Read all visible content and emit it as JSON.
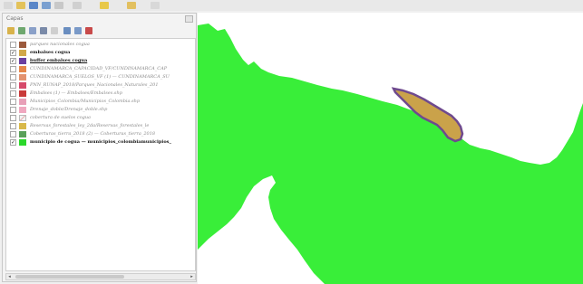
{
  "layers_panel": {
    "title": "Capas",
    "layers": [
      {
        "label": "parques nacionales cogua",
        "checked": false,
        "swatch": "#9b5a3c"
      },
      {
        "label": "embalses cogua",
        "checked": true,
        "swatch": "#d1a84a"
      },
      {
        "label": "buffer embalses cogua",
        "checked": true,
        "swatch": "#6b3fa0"
      },
      {
        "label": "CUNDINAMARCA_CAPACIDAD_VF/CUNDINAMARCA_CAP",
        "checked": false,
        "swatch": "#e6874a"
      },
      {
        "label": "CUNDINAMARCA_SUELOS_VF (1) — CUNDINAMARCA_SU",
        "checked": false,
        "swatch": "#e3926f"
      },
      {
        "label": "PNN_RUNAP_2018/Parques_Nacionales_Naturales_201",
        "checked": false,
        "swatch": "#d64a6b"
      },
      {
        "label": "Embalses (1) — Embalses/Embalses.shp",
        "checked": false,
        "swatch": "#c93a3a"
      },
      {
        "label": "Municipios_Colombia/Municipios_Colombia.shp",
        "checked": false,
        "swatch": "#e8a0b8"
      },
      {
        "label": "Drenaje_doble/Drenaje_doble.shp",
        "checked": false,
        "swatch": "#f0a8c0"
      },
      {
        "label": "cobertura de suelos cogua",
        "checked": false,
        "swatch": "#e0e0e0"
      },
      {
        "label": "Reservas_forestales_ley_2da/Reservas_forestales_le",
        "checked": false,
        "swatch": "#d8b84a"
      },
      {
        "label": "Coberturas_tierra_2018 (2) — Coberturas_tierra_2018",
        "checked": false,
        "swatch": "#5aa05a"
      },
      {
        "label": "municipio de cogua — municipios_colombiamunicipios_",
        "checked": true,
        "swatch": "#2bd82b"
      }
    ],
    "active_layer_index": 2
  },
  "map": {
    "land_color": "#39ee39",
    "reservoir_fill": "#caa24a",
    "reservoir_stroke": "#6f4a8e"
  },
  "icons": {
    "panel_toolbar": [
      "open-layer-styling-icon",
      "add-group-icon",
      "manage-map-themes-icon",
      "filter-legend-icon",
      "expression-filter-icon",
      "expand-all-icon",
      "collapse-all-icon",
      "remove-layer-icon"
    ],
    "scroll_left": "◂",
    "scroll_right": "▸",
    "check": "✓"
  }
}
